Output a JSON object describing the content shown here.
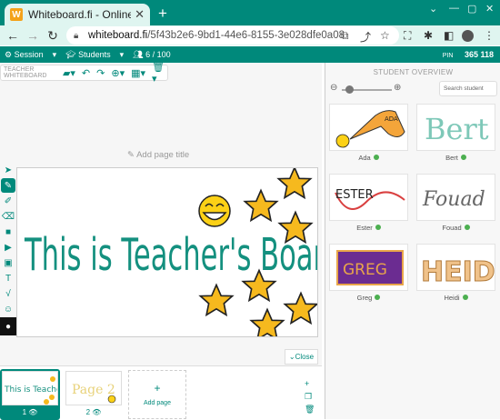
{
  "browser": {
    "tab_title": "Whiteboard.fi - Online wh",
    "favicon_letter": "W",
    "url_domain": "whiteboard.fi",
    "url_path": "/5f43b2e6-9bd1-44e6-8155-3e028dfe0a08"
  },
  "app": {
    "session_label": "Session",
    "students_label": "Students",
    "student_count": "6 / 100",
    "pin_label": "PIN",
    "pin_value": "365 118"
  },
  "teacher": {
    "toolbar_label": "TEACHER WHITEBOARD",
    "add_page_title": "Add page title",
    "board_text": "This is Teacher's Board",
    "close_label": "Close"
  },
  "pages": [
    {
      "number": "1"
    },
    {
      "number": "2",
      "preview_text": "Page 2"
    }
  ],
  "add_page_label": "Add page",
  "overview": {
    "title": "STUDENT OVERVIEW",
    "search_placeholder": "Search student",
    "students": [
      {
        "name": "Ada",
        "board_text": "ADA"
      },
      {
        "name": "Bert",
        "board_text": "Bert"
      },
      {
        "name": "Ester",
        "board_text": "ESTER"
      },
      {
        "name": "Fouad",
        "board_text": "Fouad"
      },
      {
        "name": "Greg",
        "board_text": "GREG"
      },
      {
        "name": "Heidi",
        "board_text": "HEIDI"
      }
    ]
  },
  "colors": {
    "brand": "#00897b",
    "star": "#f6b91e",
    "ink": "#14907f"
  }
}
